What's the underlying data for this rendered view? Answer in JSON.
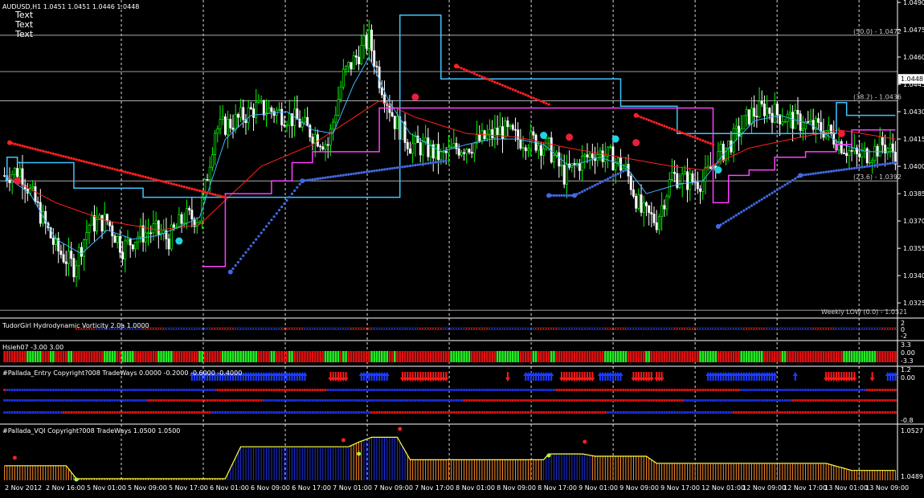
{
  "colors": {
    "background": "#000000",
    "bull_candle": "#00ff00",
    "bear_candle": "#ffffff",
    "fast_ma": "#3fb4ff",
    "slow_ma": "#ff2020",
    "stop_upper": "#40c4ff",
    "stop_lower": "#ff40ff",
    "red_dots": "#ff2020",
    "blue_dots": "#4169e1",
    "grid": "#ffffff",
    "level_line": "#c0c0c0",
    "up_arrow": "#1e3cff",
    "down_arrow": "#ff1a1a",
    "vqi_orange": "#ff8c28",
    "vqi_blue": "#1c2fe0",
    "vqi_line": "#ffff40"
  },
  "main": {
    "symbol_label": "AUDUSD,H1  1.0451 1.0451 1.0446 1.0448",
    "text_lines": [
      "Text",
      "Text",
      "Text"
    ],
    "current_price": "1.0448",
    "weekly_low_label": "Weekly LOW (0.0) - 1.0321",
    "fib_levels": [
      {
        "label": "(50.0) - 1.0472",
        "price": 1.0472
      },
      {
        "label": "(38.2) - 1.0436",
        "price": 1.0436
      },
      {
        "label": "(23.6) - 1.0392",
        "price": 1.0392
      }
    ],
    "price_ticks": [
      "1.0490",
      "1.0475",
      "1.0460",
      "1.0445",
      "1.0430",
      "1.0415",
      "1.0400",
      "1.0385",
      "1.0370",
      "1.0355",
      "1.0340",
      "1.0325"
    ]
  },
  "panels": {
    "vorticity": {
      "label": "TudorGirl Hydrodynamic Vorticity 2.0a 1.0000",
      "ticks": [
        "2",
        "0",
        "-2"
      ]
    },
    "hsieh": {
      "label": "Hsieh07 -3.00 3.00",
      "ticks": [
        "3.3",
        "0.00",
        "-3.3"
      ]
    },
    "entry": {
      "label": "#Pallada_Entry Copyright?008 TradeWays 0.0000 -0.2000 -0.6000 -0.4000",
      "ticks": [
        "1.2",
        "0.00",
        "-0.8"
      ]
    },
    "vqi": {
      "label": "#Pallada_VQI Copyright?008 TradeWays 1.0500 1.0500",
      "ticks": [
        "1.0527",
        "1.0489"
      ]
    }
  },
  "time_axis": [
    "2 Nov 2012",
    "2 Nov 16:00",
    "5 Nov 01:00",
    "5 Nov 09:00",
    "5 Nov 17:00",
    "6 Nov 01:00",
    "6 Nov 09:00",
    "6 Nov 17:00",
    "7 Nov 01:00",
    "7 Nov 09:00",
    "7 Nov 17:00",
    "8 Nov 01:00",
    "8 Nov 09:00",
    "8 Nov 17:00",
    "9 Nov 01:00",
    "9 Nov 09:00",
    "9 Nov 17:00",
    "12 Nov 01:00",
    "12 Nov 09:00",
    "12 Nov 17:00",
    "13 Nov 01:00",
    "13 Nov 09:00"
  ],
  "chart_data": {
    "type": "candlestick",
    "symbol": "AUDUSD",
    "timeframe": "H1",
    "ylim": [
      1.0318,
      1.049
    ],
    "grid": true,
    "close_anchors": [
      [
        0,
        1.0395
      ],
      [
        6,
        1.0398
      ],
      [
        12,
        1.038
      ],
      [
        20,
        1.0355
      ],
      [
        27,
        1.0345
      ],
      [
        33,
        1.0368
      ],
      [
        40,
        1.037
      ],
      [
        46,
        1.0355
      ],
      [
        52,
        1.0362
      ],
      [
        58,
        1.0365
      ],
      [
        64,
        1.036
      ],
      [
        70,
        1.0372
      ],
      [
        76,
        1.0372
      ],
      [
        82,
        1.042
      ],
      [
        90,
        1.0425
      ],
      [
        98,
        1.0432
      ],
      [
        106,
        1.043
      ],
      [
        114,
        1.0425
      ],
      [
        120,
        1.0418
      ],
      [
        126,
        1.0412
      ],
      [
        132,
        1.045
      ],
      [
        138,
        1.0462
      ],
      [
        142,
        1.047
      ],
      [
        146,
        1.0448
      ],
      [
        152,
        1.0425
      ],
      [
        158,
        1.0412
      ],
      [
        164,
        1.041
      ],
      [
        170,
        1.0405
      ],
      [
        176,
        1.041
      ],
      [
        182,
        1.0412
      ],
      [
        188,
        1.0416
      ],
      [
        194,
        1.042
      ],
      [
        200,
        1.0415
      ],
      [
        206,
        1.0414
      ],
      [
        212,
        1.041
      ],
      [
        218,
        1.0395
      ],
      [
        224,
        1.0402
      ],
      [
        230,
        1.0408
      ],
      [
        236,
        1.0405
      ],
      [
        242,
        1.0398
      ],
      [
        248,
        1.0375
      ],
      [
        254,
        1.037
      ],
      [
        260,
        1.0395
      ],
      [
        266,
        1.0392
      ],
      [
        272,
        1.0392
      ],
      [
        278,
        1.0405
      ],
      [
        284,
        1.0415
      ],
      [
        290,
        1.0428
      ],
      [
        296,
        1.0432
      ],
      [
        302,
        1.0428
      ],
      [
        308,
        1.0425
      ],
      [
        314,
        1.0422
      ],
      [
        320,
        1.042
      ],
      [
        326,
        1.0412
      ],
      [
        332,
        1.0405
      ],
      [
        338,
        1.0408
      ],
      [
        342,
        1.0412
      ],
      [
        347,
        1.0407
      ]
    ],
    "fast_ma_anchors": [
      [
        0,
        1.0395
      ],
      [
        10,
        1.0385
      ],
      [
        20,
        1.036
      ],
      [
        30,
        1.0352
      ],
      [
        40,
        1.0365
      ],
      [
        50,
        1.036
      ],
      [
        60,
        1.0362
      ],
      [
        70,
        1.0368
      ],
      [
        76,
        1.0372
      ],
      [
        86,
        1.0415
      ],
      [
        96,
        1.0428
      ],
      [
        110,
        1.043
      ],
      [
        120,
        1.042
      ],
      [
        128,
        1.0418
      ],
      [
        136,
        1.0445
      ],
      [
        142,
        1.046
      ],
      [
        150,
        1.0435
      ],
      [
        158,
        1.0418
      ],
      [
        170,
        1.0408
      ],
      [
        180,
        1.0412
      ],
      [
        190,
        1.0415
      ],
      [
        200,
        1.0415
      ],
      [
        210,
        1.0412
      ],
      [
        220,
        1.04
      ],
      [
        232,
        1.0405
      ],
      [
        242,
        1.04
      ],
      [
        250,
        1.0385
      ],
      [
        262,
        1.039
      ],
      [
        272,
        1.0392
      ],
      [
        282,
        1.041
      ],
      [
        292,
        1.0425
      ],
      [
        302,
        1.0428
      ],
      [
        314,
        1.0423
      ],
      [
        326,
        1.0412
      ],
      [
        336,
        1.0408
      ],
      [
        347,
        1.0408
      ]
    ],
    "slow_ma_anchors": [
      [
        0,
        1.0395
      ],
      [
        20,
        1.038
      ],
      [
        40,
        1.037
      ],
      [
        60,
        1.0365
      ],
      [
        76,
        1.0368
      ],
      [
        100,
        1.04
      ],
      [
        120,
        1.0412
      ],
      [
        146,
        1.0436
      ],
      [
        160,
        1.0427
      ],
      [
        180,
        1.0418
      ],
      [
        200,
        1.0416
      ],
      [
        220,
        1.041
      ],
      [
        240,
        1.0405
      ],
      [
        260,
        1.04
      ],
      [
        272,
        1.0398
      ],
      [
        290,
        1.041
      ],
      [
        310,
        1.0416
      ],
      [
        325,
        1.042
      ],
      [
        347,
        1.0415
      ]
    ],
    "upper_stop_steps": [
      [
        0,
        1.0392
      ],
      [
        1,
        1.0405
      ],
      [
        5,
        1.0402
      ],
      [
        17,
        1.0402
      ],
      [
        27,
        1.0388
      ],
      [
        54,
        1.0383
      ],
      [
        76,
        1.0383
      ],
      [
        154,
        1.0483
      ],
      [
        170,
        1.0448
      ],
      [
        220,
        1.0448
      ],
      [
        240,
        1.0433
      ],
      [
        262,
        1.0418
      ],
      [
        276,
        1.0418
      ],
      [
        324,
        1.0435
      ],
      [
        328,
        1.0428
      ],
      [
        347,
        1.0428
      ]
    ],
    "lower_stop_steps": [
      [
        77,
        1.0345
      ],
      [
        84,
        1.0345
      ],
      [
        86,
        1.0385
      ],
      [
        104,
        1.0392
      ],
      [
        112,
        1.0402
      ],
      [
        120,
        1.0408
      ],
      [
        134,
        1.0408
      ],
      [
        146,
        1.0432
      ],
      [
        154,
        1.0432
      ],
      [
        276,
        1.038
      ],
      [
        282,
        1.0395
      ],
      [
        290,
        1.0398
      ],
      [
        300,
        1.0405
      ],
      [
        312,
        1.0408
      ],
      [
        324,
        1.0412
      ],
      [
        330,
        1.042
      ],
      [
        347,
        1.042
      ]
    ],
    "red_trails": [
      {
        "from": 2,
        "to": 86,
        "start": 1.0413,
        "end": 1.0383
      },
      {
        "from": 176,
        "to": 212,
        "start": 1.0455,
        "end": 1.0434
      },
      {
        "from": 246,
        "to": 276,
        "start": 1.0428,
        "end": 1.0412
      }
    ],
    "blue_trails": [
      {
        "from": 88,
        "to": 116,
        "start": 1.0342,
        "end": 1.0392
      },
      {
        "from": 116,
        "to": 172,
        "start": 1.0392,
        "end": 1.0403
      },
      {
        "from": 212,
        "to": 222,
        "start": 1.0384,
        "end": 1.0384
      },
      {
        "from": 222,
        "to": 242,
        "start": 1.0384,
        "end": 1.0398
      },
      {
        "from": 278,
        "to": 310,
        "start": 1.0367,
        "end": 1.0395
      },
      {
        "from": 310,
        "to": 347,
        "start": 1.0395,
        "end": 1.0402
      }
    ],
    "signals": [
      {
        "bar": 5,
        "price": 1.0392,
        "color": "red"
      },
      {
        "bar": 68,
        "price": 1.0359,
        "color": "cyan"
      },
      {
        "bar": 160,
        "price": 1.0438,
        "color": "red"
      },
      {
        "bar": 210,
        "price": 1.0417,
        "color": "cyan"
      },
      {
        "bar": 220,
        "price": 1.0416,
        "color": "red"
      },
      {
        "bar": 238,
        "price": 1.0415,
        "color": "cyan"
      },
      {
        "bar": 246,
        "price": 1.0413,
        "color": "red"
      },
      {
        "bar": 278,
        "price": 1.0398,
        "color": "cyan"
      },
      {
        "bar": 326,
        "price": 1.0418,
        "color": "red"
      }
    ],
    "hsieh_bars": "RRRRRGGGRRGRRRGRRRRRRRGGGRGGGRRRRRGGGRRRRRRGRRRRGGGGGGGGRRRGRRRGRRRRRRRGGGRGRRRRRGGGGRGRRRRRRRRRRRRGGGGRRRRRRGGGGGRRRGRRRGRRRRRRRRRRRGGGGGRRRRGRRRRRRRRRRRGGGGRRRRRGGGGGRRRRGRRRRRRRRRRRRRGGGGGGGRRRRR",
    "entry_arrows": [
      {
        "from": 73,
        "to": 117,
        "dir": "up"
      },
      {
        "from": 127,
        "to": 133,
        "dir": "down"
      },
      {
        "from": 139,
        "to": 149,
        "dir": "up"
      },
      {
        "from": 155,
        "to": 172,
        "dir": "down"
      },
      {
        "from": 196,
        "to": 196,
        "dir": "down"
      },
      {
        "from": 203,
        "to": 213,
        "dir": "up"
      },
      {
        "from": 217,
        "to": 229,
        "dir": "down"
      },
      {
        "from": 232,
        "to": 240,
        "dir": "up"
      },
      {
        "from": 245,
        "to": 252,
        "dir": "down"
      },
      {
        "from": 254,
        "to": 256,
        "dir": "down"
      },
      {
        "from": 274,
        "to": 300,
        "dir": "up"
      },
      {
        "from": 308,
        "to": 308,
        "dir": "up"
      },
      {
        "from": 320,
        "to": 331,
        "dir": "down"
      },
      {
        "from": 338,
        "to": 338,
        "dir": "down"
      },
      {
        "from": 344,
        "to": 347,
        "dir": "up"
      }
    ],
    "vqi_anchors": [
      [
        0,
        1.05
      ],
      [
        24,
        1.05
      ],
      [
        28,
        1.0489
      ],
      [
        86,
        1.0489
      ],
      [
        92,
        1.0516
      ],
      [
        134,
        1.0516
      ],
      [
        138,
        1.052
      ],
      [
        143,
        1.0524
      ],
      [
        153,
        1.0524
      ],
      [
        158,
        1.0505
      ],
      [
        210,
        1.0505
      ],
      [
        212,
        1.051
      ],
      [
        225,
        1.051
      ],
      [
        230,
        1.0508
      ],
      [
        250,
        1.0508
      ],
      [
        254,
        1.0502
      ],
      [
        320,
        1.0502
      ],
      [
        330,
        1.0496
      ],
      [
        347,
        1.0496
      ]
    ],
    "vqi_blue_ranges": [
      [
        86,
        134
      ],
      [
        140,
        156
      ],
      [
        210,
        228
      ]
    ],
    "vqi_ylim": [
      1.0489,
      1.0527
    ]
  }
}
